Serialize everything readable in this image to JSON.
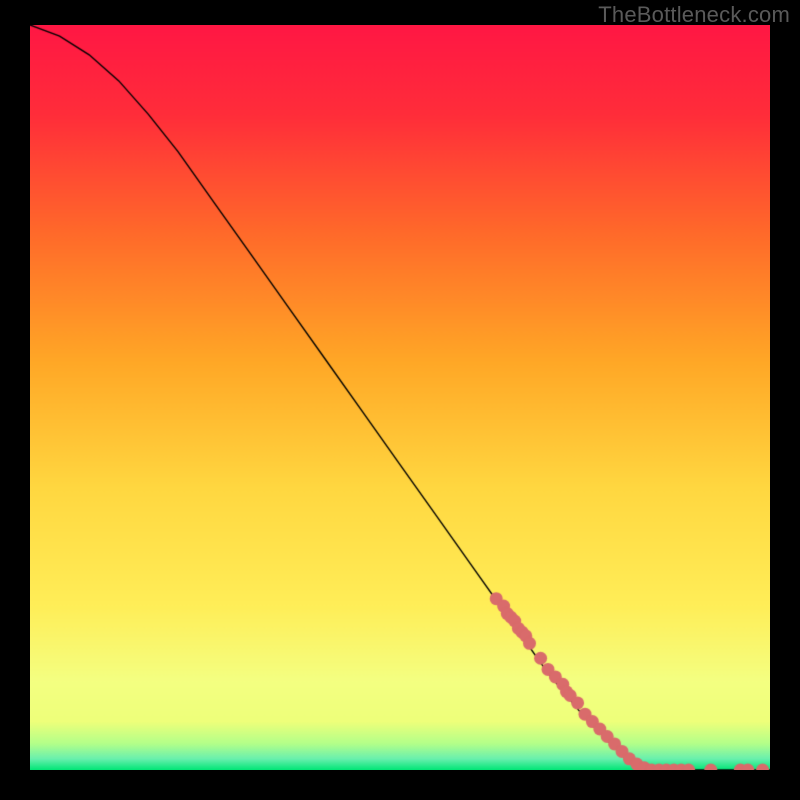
{
  "watermark": "TheBottleneck.com",
  "chart_data": {
    "type": "line",
    "title": "",
    "xlabel": "",
    "ylabel": "",
    "xlim": [
      0,
      100
    ],
    "ylim": [
      0,
      100
    ],
    "curve": [
      {
        "x": 0,
        "y": 100
      },
      {
        "x": 4,
        "y": 98.5
      },
      {
        "x": 8,
        "y": 96
      },
      {
        "x": 12,
        "y": 92.5
      },
      {
        "x": 16,
        "y": 88
      },
      {
        "x": 20,
        "y": 83
      },
      {
        "x": 25,
        "y": 76
      },
      {
        "x": 30,
        "y": 69
      },
      {
        "x": 35,
        "y": 62
      },
      {
        "x": 40,
        "y": 55
      },
      {
        "x": 45,
        "y": 48
      },
      {
        "x": 50,
        "y": 41
      },
      {
        "x": 55,
        "y": 34
      },
      {
        "x": 60,
        "y": 27
      },
      {
        "x": 65,
        "y": 20
      },
      {
        "x": 70,
        "y": 13
      },
      {
        "x": 75,
        "y": 7
      },
      {
        "x": 80,
        "y": 2
      },
      {
        "x": 82,
        "y": 0.5
      },
      {
        "x": 85,
        "y": 0
      },
      {
        "x": 90,
        "y": 0
      },
      {
        "x": 95,
        "y": 0
      },
      {
        "x": 100,
        "y": 0
      }
    ],
    "data_points": [
      {
        "x": 63,
        "y": 23
      },
      {
        "x": 64,
        "y": 22
      },
      {
        "x": 64.5,
        "y": 21
      },
      {
        "x": 65,
        "y": 20.5
      },
      {
        "x": 65.5,
        "y": 20
      },
      {
        "x": 66,
        "y": 19
      },
      {
        "x": 66.5,
        "y": 18.5
      },
      {
        "x": 67,
        "y": 18
      },
      {
        "x": 67.5,
        "y": 17
      },
      {
        "x": 69,
        "y": 15
      },
      {
        "x": 70,
        "y": 13.5
      },
      {
        "x": 71,
        "y": 12.5
      },
      {
        "x": 72,
        "y": 11.5
      },
      {
        "x": 72.5,
        "y": 10.5
      },
      {
        "x": 73,
        "y": 10
      },
      {
        "x": 74,
        "y": 9
      },
      {
        "x": 75,
        "y": 7.5
      },
      {
        "x": 76,
        "y": 6.5
      },
      {
        "x": 77,
        "y": 5.5
      },
      {
        "x": 78,
        "y": 4.5
      },
      {
        "x": 79,
        "y": 3.5
      },
      {
        "x": 80,
        "y": 2.5
      },
      {
        "x": 81,
        "y": 1.5
      },
      {
        "x": 82,
        "y": 0.8
      },
      {
        "x": 83,
        "y": 0.3
      },
      {
        "x": 84,
        "y": 0
      },
      {
        "x": 85,
        "y": 0
      },
      {
        "x": 86,
        "y": 0
      },
      {
        "x": 87,
        "y": 0
      },
      {
        "x": 88,
        "y": 0
      },
      {
        "x": 89,
        "y": 0
      },
      {
        "x": 92,
        "y": 0
      },
      {
        "x": 96,
        "y": 0
      },
      {
        "x": 97,
        "y": 0
      },
      {
        "x": 99,
        "y": 0
      }
    ],
    "gradient_stops": [
      {
        "offset": 0.0,
        "color": "#ff1744"
      },
      {
        "offset": 0.12,
        "color": "#ff2d3a"
      },
      {
        "offset": 0.28,
        "color": "#ff6a2a"
      },
      {
        "offset": 0.45,
        "color": "#ffa726"
      },
      {
        "offset": 0.62,
        "color": "#ffd740"
      },
      {
        "offset": 0.78,
        "color": "#ffee58"
      },
      {
        "offset": 0.88,
        "color": "#f4ff81"
      },
      {
        "offset": 0.935,
        "color": "#eeff7a"
      },
      {
        "offset": 0.965,
        "color": "#b2ff8a"
      },
      {
        "offset": 0.985,
        "color": "#69f0ae"
      },
      {
        "offset": 1.0,
        "color": "#00e676"
      }
    ],
    "point_color": "#d96b6b",
    "curve_color": "#000000"
  }
}
